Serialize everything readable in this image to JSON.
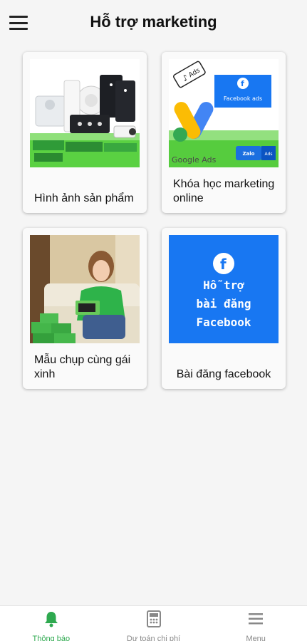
{
  "header": {
    "title": "Hỗ trợ marketing"
  },
  "cards": [
    {
      "label": "Hình ảnh sản phẩm"
    },
    {
      "label": "Khóa học marketing online",
      "image_text": {
        "ads_tag": "Ads",
        "facebook_ads": "Facebook ads",
        "google_ads": "Google Ads",
        "zalo": "Zalo",
        "zalo_ads": "Ads"
      }
    },
    {
      "label": "Mẫu chụp cùng gái xinh"
    },
    {
      "label": "Bài đăng facebook",
      "image_text": {
        "line1": "Hỗ trợ",
        "line2": "bài đăng",
        "line3": "Facebook"
      }
    }
  ],
  "bottom_nav": [
    {
      "label": "Thông báo",
      "icon": "bell-icon",
      "active": true
    },
    {
      "label": "Dự toán chi phí",
      "icon": "calculator-icon",
      "active": false
    },
    {
      "label": "Menu",
      "icon": "menu-icon",
      "active": false
    }
  ],
  "colors": {
    "accent_green": "#2ea94f",
    "facebook_blue": "#1877f2",
    "background": "#f5f5f5",
    "inactive": "#888888"
  }
}
